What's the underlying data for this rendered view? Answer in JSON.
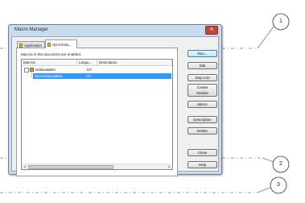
{
  "dialog": {
    "title": "Macro Manager",
    "close_glyph": "✕"
  },
  "tabs": [
    {
      "label": "Application"
    },
    {
      "label": "SyncGridL..."
    }
  ],
  "status_text": "Macros in this document are enabled.",
  "columns": [
    "Macros",
    "Langu...",
    "Description"
  ],
  "rows": [
    {
      "expander": "−",
      "name": "GridLeaders",
      "language": "C#",
      "description": "",
      "selected": false
    },
    {
      "expander": "",
      "name": "SyncGridLeaders",
      "language": "C#",
      "description": "",
      "selected": true
    }
  ],
  "scrollbar": {
    "left_arrow": "◂",
    "right_arrow": "▸"
  },
  "buttons": {
    "run": "Run...",
    "edit": "Edit",
    "step_into": "Step Into",
    "create": "Create",
    "module": "Module",
    "macro": "Macro",
    "description": "Description",
    "delete": "Delete",
    "close": "Close",
    "help": "Help"
  },
  "callouts": [
    "1",
    "2",
    "3"
  ],
  "colors": {
    "selection": "#3399ff",
    "dialog_frame": "#c9dbee",
    "close_button": "#c7463c"
  },
  "icons": [
    "close-icon",
    "macro-tab-icon",
    "module-icon",
    "scroll-left-icon",
    "scroll-right-icon"
  ]
}
